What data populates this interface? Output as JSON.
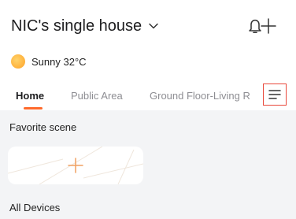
{
  "header": {
    "home_name": "NIC's single house"
  },
  "weather": {
    "condition": "Sunny",
    "temperature": "32°C"
  },
  "tabs": [
    {
      "label": "Home",
      "active": true
    },
    {
      "label": "Public Area",
      "active": false
    },
    {
      "label": "Ground Floor-Living R",
      "active": false
    }
  ],
  "sections": {
    "favorite_scene": "Favorite scene",
    "all_devices": "All Devices"
  },
  "icons": {
    "dropdown": "chevron-down-icon",
    "notifications": "bell-icon",
    "add": "plus-icon",
    "weather": "sun-icon",
    "tab_menu": "menu-icon",
    "add_scene": "plus-icon"
  },
  "colors": {
    "accent": "#ff6a2b",
    "menu_highlight": "#e9483b",
    "sun": "#ffb13b",
    "content_bg": "#f3f4f6"
  }
}
